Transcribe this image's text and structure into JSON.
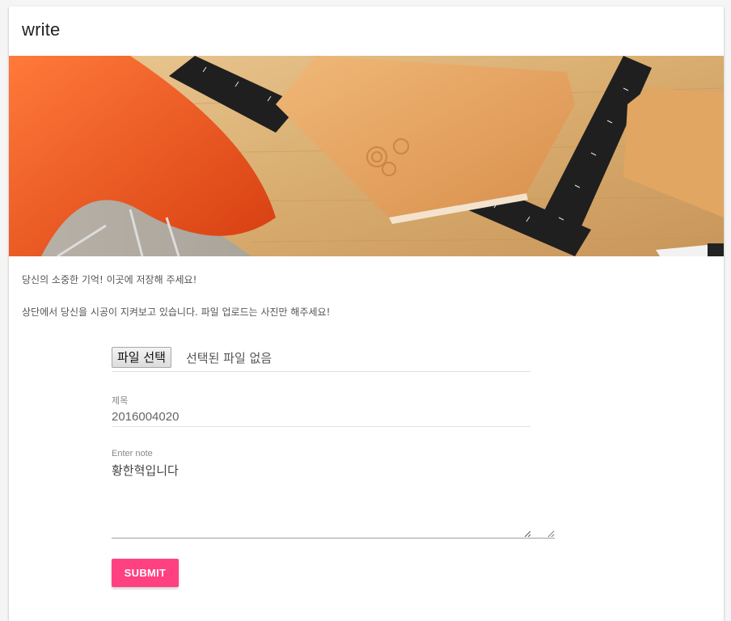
{
  "card": {
    "title": "write"
  },
  "hero": {
    "image": "leather-notebook-ruler-desk-photo"
  },
  "description": {
    "line1": "당신의 소중한 기억! 이곳에 저장해 주세요!",
    "line2": "상단에서 당신을 시공이 지켜보고 있습니다. 파일 업로드는 사진만 해주세요!"
  },
  "form": {
    "file_button_label": "파일 선택",
    "file_status": "선택된 파일 없음",
    "title_label": "제목",
    "title_value": "2016004020",
    "note_label": "Enter note",
    "note_value": "황한혁입니다",
    "submit_label": "SUBMIT"
  },
  "colors": {
    "accent": "#ff4081"
  }
}
